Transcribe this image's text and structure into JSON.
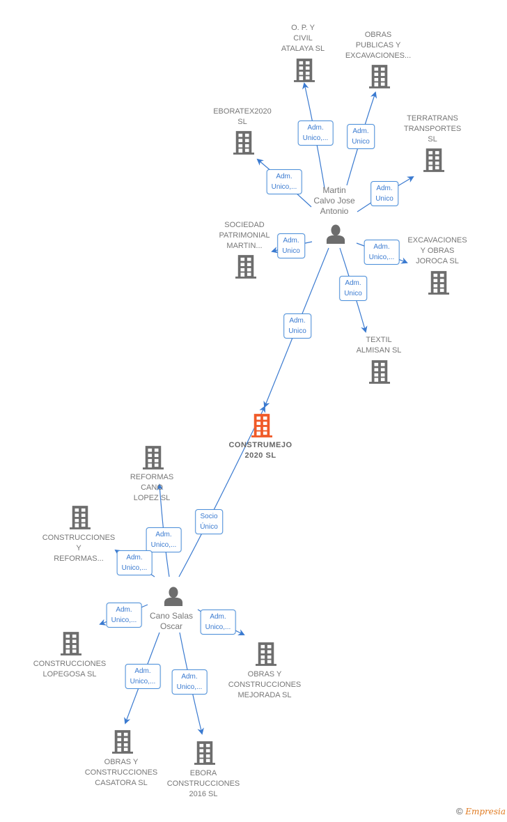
{
  "colors": {
    "edge": "#3a7ad0",
    "building": "#6d6d6d",
    "main_building": "#f05a28",
    "person": "#6d6d6d",
    "label": "#777777"
  },
  "persons": [
    {
      "id": "p1",
      "name": "Martin\nCalvo Jose\nAntonio",
      "icon": "person-icon"
    },
    {
      "id": "p2",
      "name": "Cano Salas\nOscar",
      "icon": "person-icon"
    }
  ],
  "companies": [
    {
      "id": "c0",
      "name": "CONSTRUMEJO\n2020  SL",
      "main": true,
      "icon": "building-icon"
    },
    {
      "id": "c1",
      "name": "O.  P. Y\nCIVIL\nATALAYA  SL",
      "icon": "building-icon"
    },
    {
      "id": "c2",
      "name": "OBRAS\nPUBLICAS Y\nEXCAVACIONES...",
      "icon": "building-icon"
    },
    {
      "id": "c3",
      "name": "EBORATEX2020\nSL",
      "icon": "building-icon"
    },
    {
      "id": "c4",
      "name": "TERRATRANS\nTRANSPORTES\nSL",
      "icon": "building-icon"
    },
    {
      "id": "c5",
      "name": "SOCIEDAD\nPATRIMONIAL\nMARTIN...",
      "icon": "building-icon"
    },
    {
      "id": "c6",
      "name": "EXCAVACIONES\nY OBRAS\nJOROCA SL",
      "icon": "building-icon"
    },
    {
      "id": "c7",
      "name": "TEXTIL\nALMISAN SL",
      "icon": "building-icon"
    },
    {
      "id": "c8",
      "name": "REFORMAS\nCANO\nLOPEZ  SL",
      "icon": "building-icon"
    },
    {
      "id": "c9",
      "name": "CONSTRUCCIONES\nY\nREFORMAS...",
      "icon": "building-icon"
    },
    {
      "id": "c10",
      "name": "CONSTRUCCIONES\nLOPEGOSA SL",
      "icon": "building-icon"
    },
    {
      "id": "c11",
      "name": "OBRAS Y\nCONSTRUCCIONES\nMEJORADA  SL",
      "icon": "building-icon"
    },
    {
      "id": "c12",
      "name": "OBRAS Y\nCONSTRUCCIONES\nCASATORA  SL",
      "icon": "building-icon"
    },
    {
      "id": "c13",
      "name": "EBORA\nCONSTRUCCIONES\n2016  SL",
      "icon": "building-icon"
    }
  ],
  "edges": [
    {
      "from": "p1",
      "to": "c1",
      "label": "Adm.\nUnico,..."
    },
    {
      "from": "p1",
      "to": "c2",
      "label": "Adm.\nUnico"
    },
    {
      "from": "p1",
      "to": "c3",
      "label": "Adm.\nUnico,..."
    },
    {
      "from": "p1",
      "to": "c4",
      "label": "Adm.\nUnico"
    },
    {
      "from": "p1",
      "to": "c5",
      "label": "Adm.\nUnico"
    },
    {
      "from": "p1",
      "to": "c6",
      "label": "Adm.\nUnico,..."
    },
    {
      "from": "p1",
      "to": "c7",
      "label": "Adm.\nUnico"
    },
    {
      "from": "p1",
      "to": "c0",
      "label": "Adm.\nUnico"
    },
    {
      "from": "p2",
      "to": "c0",
      "label": "Socio\nÚnico"
    },
    {
      "from": "p2",
      "to": "c8",
      "label": "Adm.\nUnico,..."
    },
    {
      "from": "p2",
      "to": "c9",
      "label": "Adm.\nUnico,..."
    },
    {
      "from": "p2",
      "to": "c10",
      "label": "Adm.\nUnico,..."
    },
    {
      "from": "p2",
      "to": "c11",
      "label": "Adm.\nUnico,..."
    },
    {
      "from": "p2",
      "to": "c12",
      "label": "Adm.\nUnico,..."
    },
    {
      "from": "p2",
      "to": "c13",
      "label": "Adm.\nUnico,..."
    }
  ],
  "footer": {
    "copyright_symbol": "©",
    "brand": "Empresia"
  }
}
